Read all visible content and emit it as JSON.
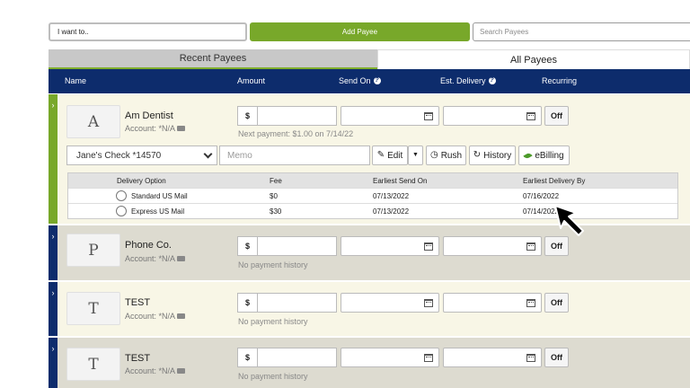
{
  "top": {
    "want_to": "I want to..",
    "add_payee": "Add Payee",
    "search_placeholder": "Search Payees"
  },
  "tabs": {
    "recent": "Recent Payees",
    "all": "All Payees"
  },
  "header": {
    "name": "Name",
    "amount": "Amount",
    "send_on": "Send On",
    "est_delivery": "Est. Delivery",
    "recurring": "Recurring"
  },
  "payees": [
    {
      "initial": "A",
      "name": "Am Dentist",
      "account": "Account: *N/A",
      "currency": "$",
      "recurring": "Off",
      "history": "Next payment: $1.00 on 7/14/22",
      "account_select": "Jane's Check *14570",
      "memo_placeholder": "Memo",
      "actions": {
        "edit": "Edit",
        "rush": "Rush",
        "history": "History",
        "ebilling": "eBilling"
      },
      "delivery": {
        "headers": [
          "Delivery Option",
          "Fee",
          "Earliest Send On",
          "Earliest Delivery By"
        ],
        "options": [
          {
            "option": "Standard US Mail",
            "fee": "$0",
            "send_on": "07/13/2022",
            "delivery_by": "07/16/2022"
          },
          {
            "option": "Express US Mail",
            "fee": "$30",
            "send_on": "07/13/2022",
            "delivery_by": "07/14/2022"
          }
        ]
      }
    },
    {
      "initial": "P",
      "name": "Phone Co.",
      "account": "Account: *N/A",
      "currency": "$",
      "recurring": "Off",
      "history": "No payment history"
    },
    {
      "initial": "T",
      "name": "TEST",
      "account": "Account: *N/A",
      "currency": "$",
      "recurring": "Off",
      "history": "No payment history"
    },
    {
      "initial": "T",
      "name": "TEST",
      "account": "Account: *N/A",
      "currency": "$",
      "recurring": "Off",
      "history": "No payment history"
    }
  ],
  "colors": {
    "navy": "#0d2c6c",
    "green": "#78a82a",
    "expanded_bg": "#f8f6e6",
    "collapsed_bg": "#dddbd0"
  }
}
